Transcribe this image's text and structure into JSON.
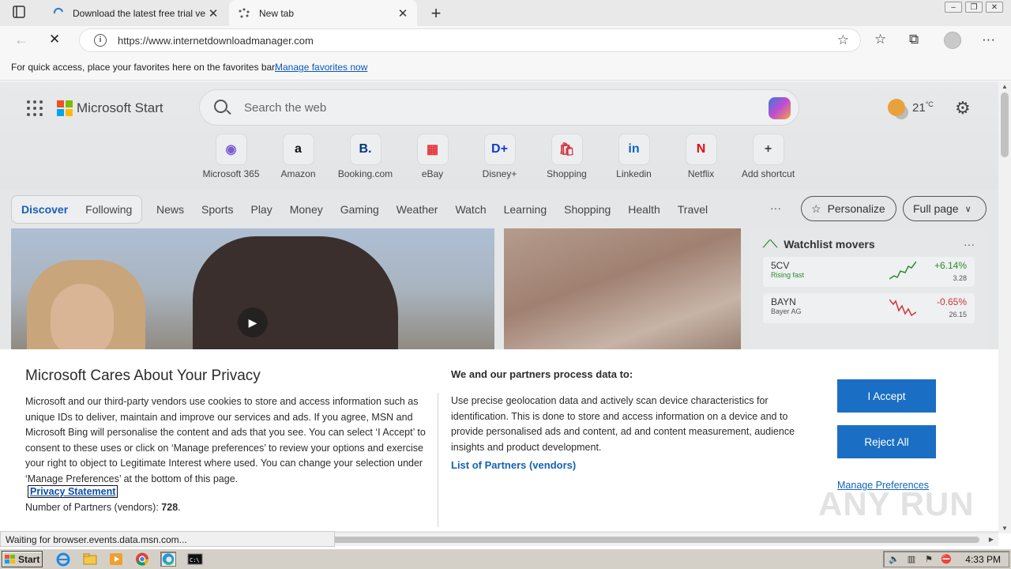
{
  "browser": {
    "tabs": [
      {
        "title": "Download the latest free trial ve",
        "active": false
      },
      {
        "title": "New tab",
        "active": true
      }
    ],
    "address": {
      "url": "https://www.internetdownloadmanager.com"
    },
    "favorites_bar": {
      "message": "For quick access, place your favorites here on the favorites bar.",
      "link": "Manage favorites now"
    },
    "status": "Waiting for browser.events.data.msn.com..."
  },
  "msn": {
    "brand": "Microsoft Start",
    "search_placeholder": "Search the web",
    "weather_temp": "21",
    "weather_unit": "°C",
    "shortcuts": [
      {
        "label": "Microsoft 365",
        "icon": "microsoft-365-icon",
        "glyph": "◉",
        "color": "#7b5bd6"
      },
      {
        "label": "Amazon",
        "icon": "amazon-icon",
        "glyph": "a",
        "color": "#111111"
      },
      {
        "label": "Booking.com",
        "icon": "booking-icon",
        "glyph": "B.",
        "color": "#003580"
      },
      {
        "label": "eBay",
        "icon": "ebay-icon",
        "glyph": "▦",
        "color": "#e53238"
      },
      {
        "label": "Disney+",
        "icon": "disney-plus-icon",
        "glyph": "D+",
        "color": "#113ccf"
      },
      {
        "label": "Shopping",
        "icon": "shopping-icon",
        "glyph": "🛍",
        "color": "#d0393e"
      },
      {
        "label": "Linkedin",
        "icon": "linkedin-icon",
        "glyph": "in",
        "color": "#0a66c2"
      },
      {
        "label": "Netflix",
        "icon": "netflix-icon",
        "glyph": "N",
        "color": "#e50914"
      },
      {
        "label": "Add shortcut",
        "icon": "add-icon",
        "glyph": "+",
        "color": "#444444"
      }
    ],
    "feed_tabs": {
      "discover": "Discover",
      "following": "Following"
    },
    "categories": [
      "News",
      "Sports",
      "Play",
      "Money",
      "Gaming",
      "Weather",
      "Watch",
      "Learning",
      "Shopping",
      "Health",
      "Travel"
    ],
    "more": "···",
    "personalize": "Personalize",
    "fullpage": "Full page",
    "watchlist": {
      "title": "Watchlist movers",
      "more": "···",
      "items": [
        {
          "symbol": "5CV",
          "sub": "Rising fast",
          "change": "+6.14%",
          "price": "3.28",
          "up": true
        },
        {
          "symbol": "BAYN",
          "sub": "Bayer AG",
          "change": "-0.65%",
          "price": "26.15",
          "up": false
        }
      ]
    }
  },
  "privacy": {
    "title": "Microsoft Cares About Your Privacy",
    "body": "Microsoft and our third-party vendors use cookies to store and access information such as unique IDs to deliver, maintain and improve our services and ads. If you agree, MSN and Microsoft Bing will personalise the content and ads that you see. You can select ‘I Accept’ to consent to these uses or click on ‘Manage preferences’ to review your options and exercise your right to object to Legitimate Interest where used.  You can change your selection under ‘Manage Preferences’ at the bottom of this page.",
    "privacy_link": "Privacy Statement",
    "partners_label": "Number of Partners (vendors): ",
    "partners_count": "728",
    "partners_end": ".",
    "sub_title": "We and our partners process data to:",
    "body2": "Use precise geolocation data and actively scan device characteristics for identification. This is done to store and access information on a device and to provide personalised ads and content, ad and content measurement, audience insights and product development.",
    "vendors_link": "List of Partners (vendors)",
    "accept": "I Accept",
    "reject": "Reject All",
    "manage": "Manage Preferences",
    "watermark": "ANY RUN"
  },
  "taskbar": {
    "start": "Start",
    "clock": "4:33 PM"
  },
  "colors": {
    "accent": "#1a6fc4",
    "link": "#1263b4",
    "gain": "#2e8b2e",
    "loss": "#d13438"
  }
}
